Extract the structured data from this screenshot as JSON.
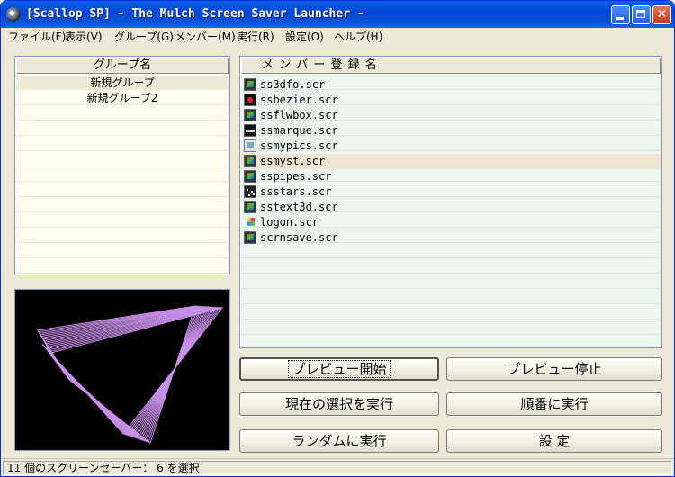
{
  "window": {
    "title": "[Scallop SP] - The Mulch Screen Saver Launcher -",
    "icon": "scallop-app-icon"
  },
  "menu": [
    {
      "label": "ファイル(F)"
    },
    {
      "label": "表示(V)"
    },
    {
      "label": "グループ(G)"
    },
    {
      "label": "メンバー(M)"
    },
    {
      "label": "実行(R)"
    },
    {
      "label": "設定(O)"
    },
    {
      "label": "ヘルプ(H)"
    }
  ],
  "groups": {
    "header": "グループ名",
    "items": [
      {
        "label": "新規グループ",
        "selected": true
      },
      {
        "label": "新規グループ2",
        "selected": false
      }
    ]
  },
  "members": {
    "header": "メ ン バ ー 登 録 名",
    "items": [
      {
        "label": "ss3dfo.scr",
        "icon": "ico-a",
        "selected": false
      },
      {
        "label": "ssbezier.scr",
        "icon": "ico-b",
        "selected": false
      },
      {
        "label": "ssflwbox.scr",
        "icon": "ico-a",
        "selected": false
      },
      {
        "label": "ssmarque.scr",
        "icon": "ico-c",
        "selected": false
      },
      {
        "label": "ssmypics.scr",
        "icon": "ico-d",
        "selected": false
      },
      {
        "label": "ssmyst.scr",
        "icon": "ico-a",
        "selected": true
      },
      {
        "label": "sspipes.scr",
        "icon": "ico-a",
        "selected": false
      },
      {
        "label": "ssstars.scr",
        "icon": "ico-e",
        "selected": false
      },
      {
        "label": "sstext3d.scr",
        "icon": "ico-a",
        "selected": false
      },
      {
        "label": "logon.scr",
        "icon": "ico-f",
        "selected": false
      },
      {
        "label": "scrnsave.scr",
        "icon": "ico-a",
        "selected": false
      }
    ]
  },
  "preview": {
    "line_color": "#c890e8"
  },
  "buttons": {
    "preview_start": "プレビュー開始",
    "preview_stop": "プレビュー停止",
    "run_selected": "現在の選択を実行",
    "run_sequential": "順番に実行",
    "run_random": "ランダムに実行",
    "settings": "設 定"
  },
  "status": {
    "text": "11 個のスクリーンセーバー： 6 を選択"
  }
}
